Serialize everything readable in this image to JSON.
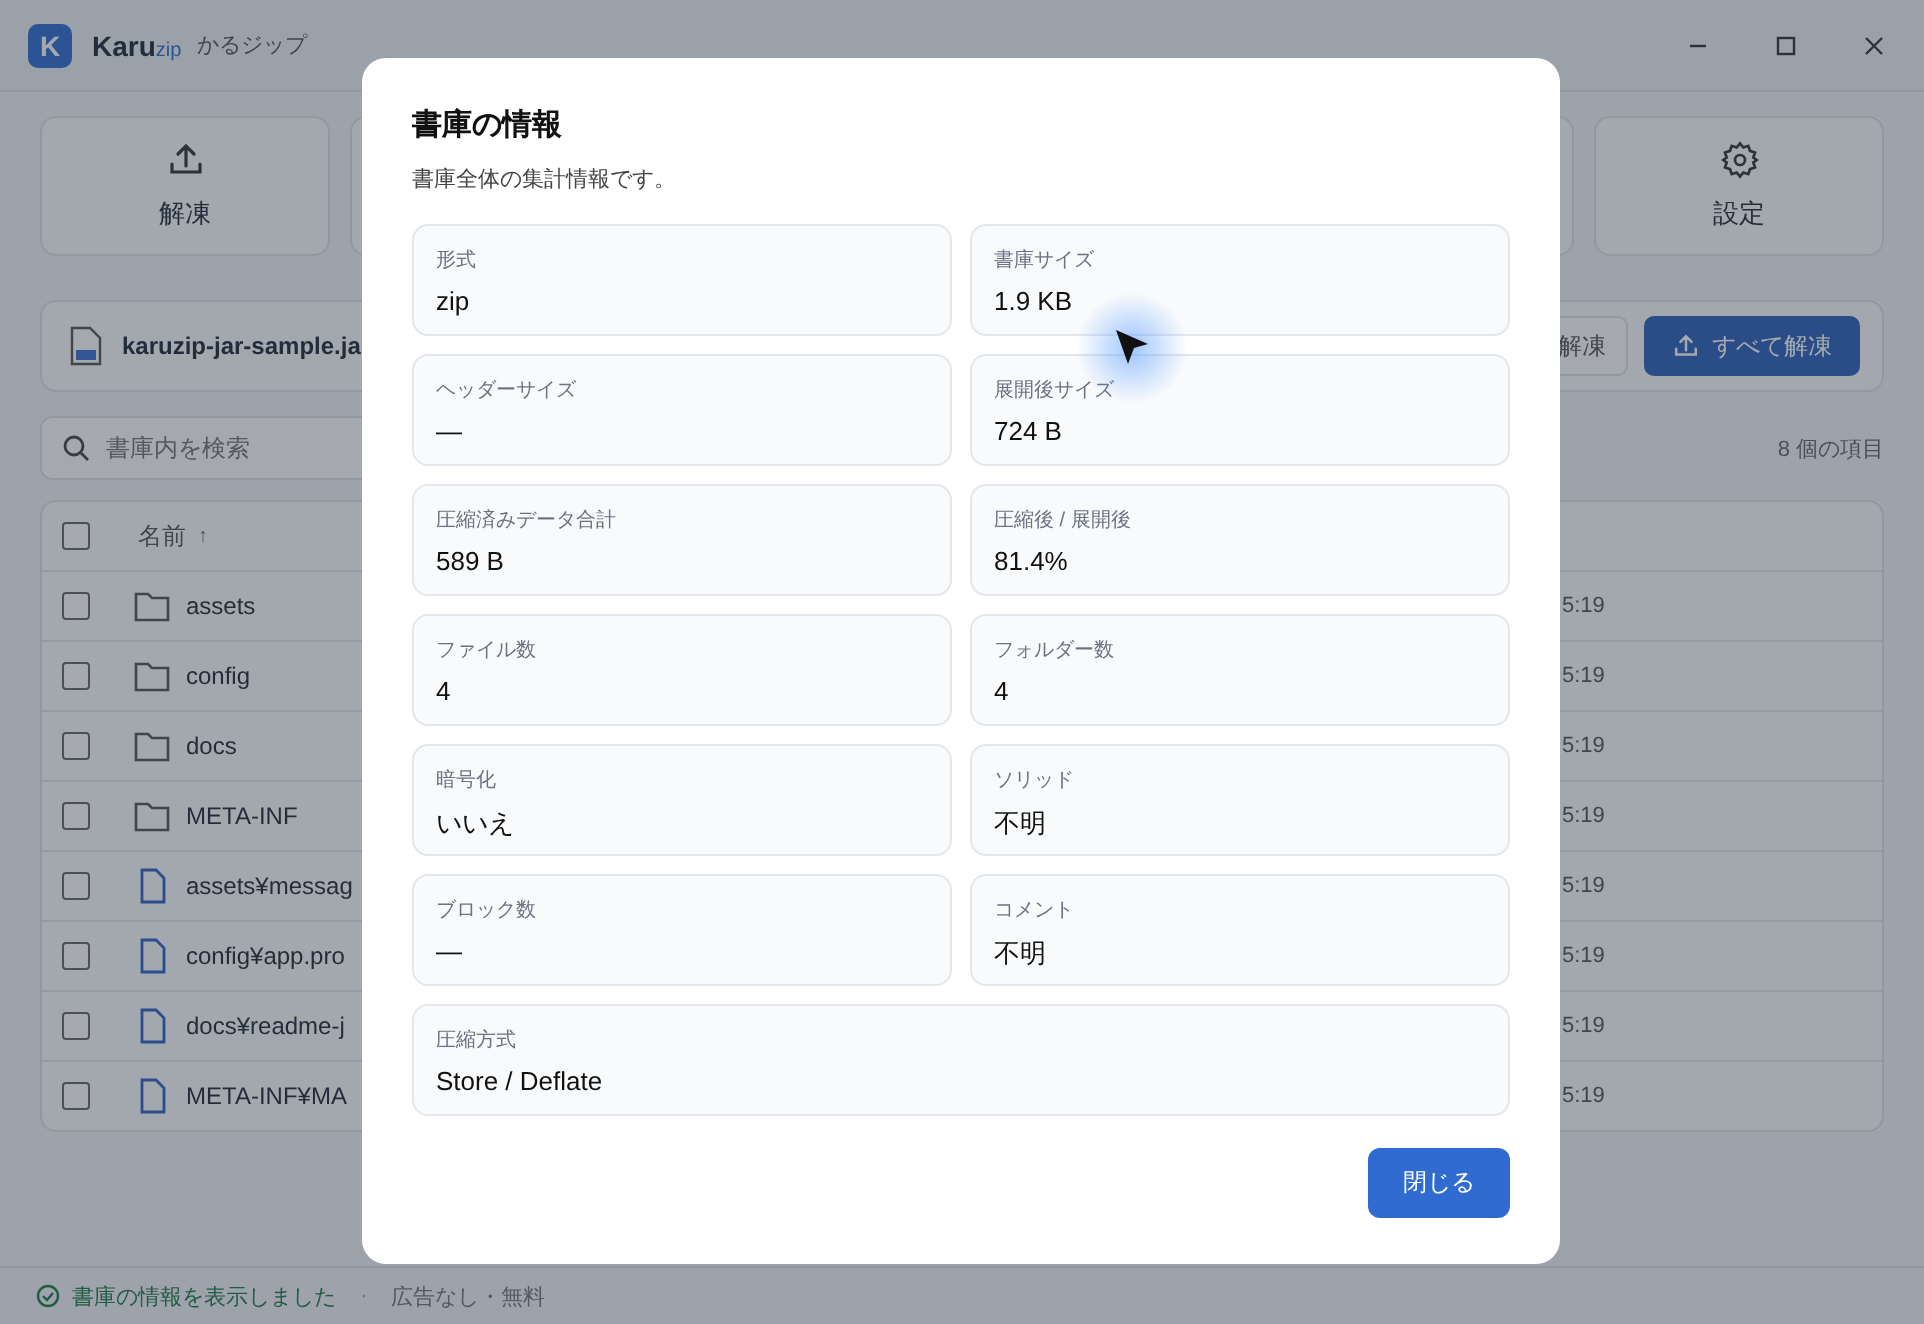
{
  "app": {
    "logo_letter": "K",
    "name": "Karu",
    "name_suffix": "zip",
    "subtitle": "かるジップ"
  },
  "toolbar": [
    {
      "label": "解凍"
    },
    {
      "label": "設定"
    }
  ],
  "archive": {
    "file_name": "karuzip-jar-sample.ja",
    "partial_button": "解凍",
    "extract_all_button": "すべて解凍"
  },
  "search": {
    "placeholder": "書庫内を検索"
  },
  "item_count": "8 個の項目",
  "table": {
    "header": {
      "name": "名前",
      "sort": "↑",
      "checked": false
    },
    "rows": [
      {
        "kind": "folder",
        "name": "assets",
        "checked": false,
        "time": "5:19"
      },
      {
        "kind": "folder",
        "name": "config",
        "checked": false,
        "time": "5:19"
      },
      {
        "kind": "folder",
        "name": "docs",
        "checked": false,
        "time": "5:19"
      },
      {
        "kind": "folder",
        "name": "META-INF",
        "checked": false,
        "time": "5:19"
      },
      {
        "kind": "file",
        "name": "assets¥messag",
        "checked": false,
        "time": "5:19"
      },
      {
        "kind": "file",
        "name": "config¥app.pro",
        "checked": false,
        "time": "5:19"
      },
      {
        "kind": "file",
        "name": "docs¥readme-j",
        "checked": false,
        "time": "5:19"
      },
      {
        "kind": "file",
        "name": "META-INF¥MA",
        "checked": false,
        "time": "5:19"
      }
    ]
  },
  "status_bar": {
    "message": "書庫の情報を表示しました",
    "separator": "·",
    "note": "広告なし・無料"
  },
  "dialog": {
    "title": "書庫の情報",
    "subtitle": "書庫全体の集計情報です。",
    "fields": [
      {
        "label": "形式",
        "value": "zip",
        "wide": false
      },
      {
        "label": "書庫サイズ",
        "value": "1.9 KB",
        "wide": false
      },
      {
        "label": "ヘッダーサイズ",
        "value": "—",
        "wide": false
      },
      {
        "label": "展開後サイズ",
        "value": "724 B",
        "wide": false
      },
      {
        "label": "圧縮済みデータ合計",
        "value": "589 B",
        "wide": false
      },
      {
        "label": "圧縮後 / 展開後",
        "value": "81.4%",
        "wide": false
      },
      {
        "label": "ファイル数",
        "value": "4",
        "wide": false
      },
      {
        "label": "フォルダー数",
        "value": "4",
        "wide": false
      },
      {
        "label": "暗号化",
        "value": "いいえ",
        "wide": false
      },
      {
        "label": "ソリッド",
        "value": "不明",
        "wide": false
      },
      {
        "label": "ブロック数",
        "value": "—",
        "wide": false
      },
      {
        "label": "コメント",
        "value": "不明",
        "wide": false
      },
      {
        "label": "圧縮方式",
        "value": "Store / Deflate",
        "wide": true
      }
    ],
    "close_button": "閉じる"
  }
}
